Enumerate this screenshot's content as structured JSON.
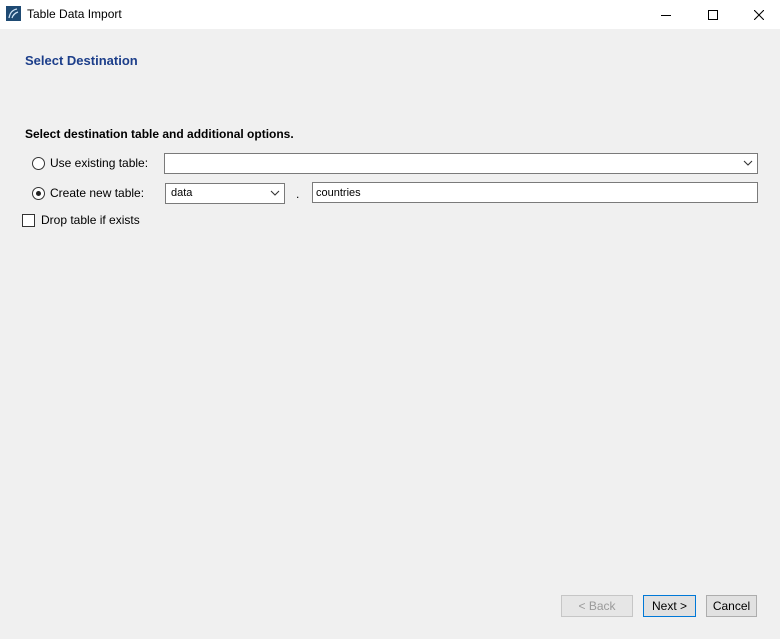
{
  "window": {
    "title": "Table Data Import",
    "icon": "mysql-workbench-icon",
    "controls": {
      "minimize": "minimize-icon",
      "maximize": "maximize-icon",
      "close": "close-icon"
    }
  },
  "page": {
    "heading": "Select Destination",
    "instructions": "Select destination table and additional options."
  },
  "options": {
    "use_existing": {
      "label": "Use existing table:",
      "selected": false,
      "value": ""
    },
    "create_new": {
      "label": "Create new table:",
      "selected": true,
      "schema": "data",
      "separator": ".",
      "table_name": "countries"
    },
    "drop_table": {
      "label": "Drop table if exists",
      "checked": false
    }
  },
  "buttons": {
    "back": "< Back",
    "next": "Next >",
    "cancel": "Cancel"
  },
  "colors": {
    "heading": "#1c3e8a",
    "background": "#f0f0f0",
    "default_button_border": "#0078d7"
  }
}
